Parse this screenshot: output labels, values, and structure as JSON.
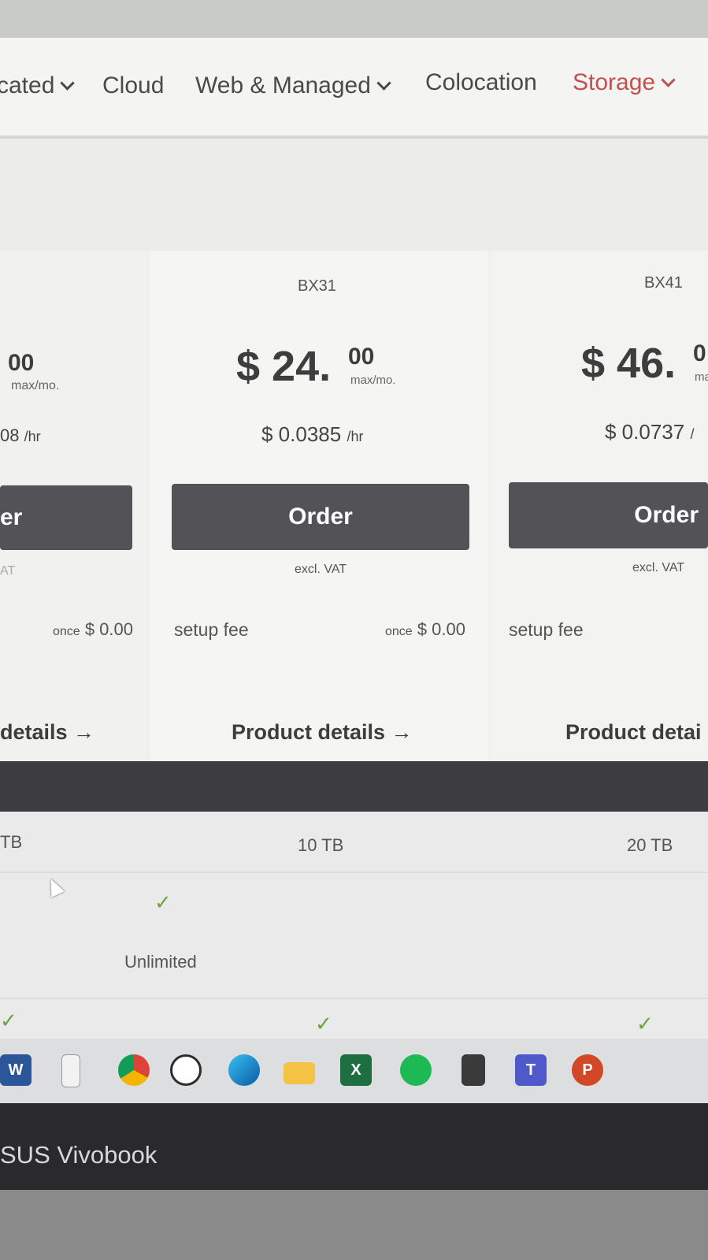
{
  "nav": {
    "items": [
      {
        "label": "cated",
        "has_chevron": true
      },
      {
        "label": "Cloud",
        "has_chevron": false
      },
      {
        "label": "Web & Managed",
        "has_chevron": true
      },
      {
        "label": "Colocation",
        "has_chevron": false
      },
      {
        "label": "Storage",
        "has_chevron": true,
        "active": true
      }
    ],
    "active_color": "#c2514f"
  },
  "plans": [
    {
      "name": "",
      "price_main": "",
      "price_cents": "00",
      "price_unit": "max/mo.",
      "hourly": "08",
      "hourly_unit": "/hr",
      "order_label": "er",
      "vat": "AT",
      "setup_once_prefix": "once",
      "setup_once_value": "$ 0.00",
      "details": "details →"
    },
    {
      "name": "BX31",
      "price_main": "$ 24.",
      "price_cents": "00",
      "price_unit": "max/mo.",
      "hourly": "$ 0.0385",
      "hourly_unit": "/hr",
      "order_label": "Order",
      "vat": "excl. VAT",
      "setup_label": "setup fee",
      "setup_once_prefix": "once",
      "setup_once_value": "$ 0.00",
      "details": "Product details →"
    },
    {
      "name": "BX41",
      "price_main": "$ 46.",
      "price_cents": "0",
      "price_unit": "ma",
      "hourly": "$ 0.0737",
      "hourly_unit": "/",
      "order_label": "Order",
      "vat": "excl. VAT",
      "setup_label": "setup fee",
      "details": "Product detai"
    }
  ],
  "table": {
    "storage": [
      "TB",
      "10 TB",
      "20 TB"
    ],
    "traffic": "Unlimited",
    "check": "✓"
  },
  "taskbar": {
    "icons": [
      "word-icon",
      "notepad-icon",
      "chrome-icon",
      "whatsapp-icon",
      "edge-icon",
      "file-explorer-icon",
      "excel-icon",
      "spotify-icon",
      "calculator-icon",
      "teams-icon",
      "powerpoint-icon"
    ],
    "word": "W",
    "excel": "X",
    "teams": "T",
    "powerpoint": "P"
  },
  "laptop": {
    "brand": "SUS Vivobook"
  }
}
